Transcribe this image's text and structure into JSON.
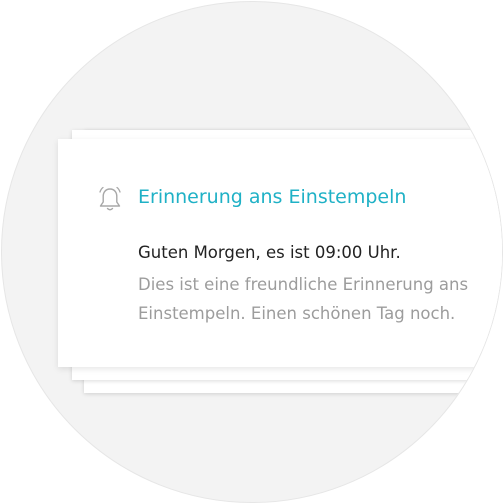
{
  "notification": {
    "icon": "bell-icon",
    "title": "Erinnerung ans Einstempeln",
    "greeting": "Guten Morgen, es ist 09:00 Uhr.",
    "message": "Dies ist eine freundliche Erinnerung ans Einstempeln. Einen schönen Tag noch."
  },
  "colors": {
    "accent": "#1fb1c6",
    "text": "#222222",
    "muted": "#9c9c9c",
    "background_circle": "#f3f3f3"
  }
}
